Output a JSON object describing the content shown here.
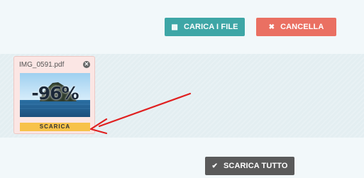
{
  "toolbar": {
    "upload_label": "CARICA I FILE",
    "upload_icon": "camera-icon",
    "cancel_label": "CANCELLA",
    "cancel_icon": "close-icon"
  },
  "file": {
    "name": "IMG_0591.pdf",
    "progress": "-96%",
    "download_label": "SCARICA",
    "remove_icon": "remove-icon"
  },
  "footer": {
    "download_all_label": "SCARICA TUTTO",
    "download_all_icon": "check-icon"
  },
  "colors": {
    "upload": "#3ea6a6",
    "cancel": "#ea7062",
    "download": "#f7c24a",
    "download_all": "#5a5a5a",
    "arrow": "#e02020"
  }
}
